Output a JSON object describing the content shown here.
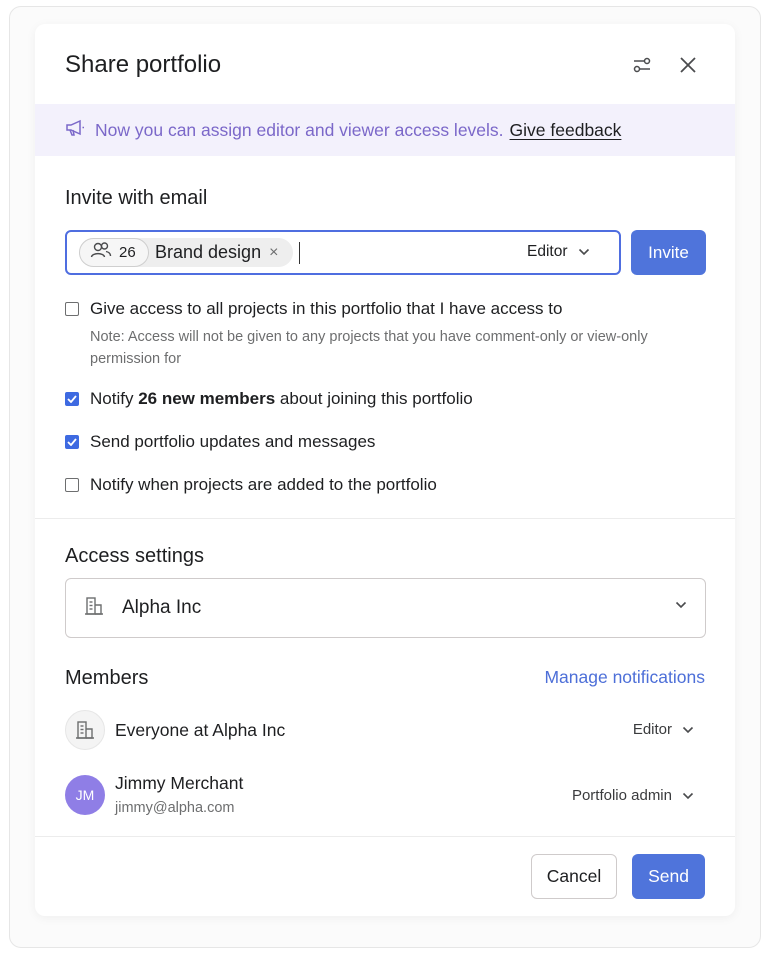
{
  "dialog": {
    "title": "Share portfolio",
    "settings_icon": "sliders-icon",
    "close_icon": "close-icon"
  },
  "banner": {
    "icon": "megaphone-icon",
    "message": "Now you can assign editor and viewer access levels.",
    "link": "Give feedback"
  },
  "invite": {
    "section_title": "Invite with email",
    "chip": {
      "icon": "team-icon",
      "count": "26",
      "label": "Brand design",
      "remove": "×"
    },
    "role": "Editor",
    "button": "Invite"
  },
  "options": [
    {
      "label": "Give access to all projects in this portfolio that I have access to",
      "checked": false
    },
    {
      "prefix": "Notify ",
      "bold": "26 new members",
      "suffix": " about joining this portfolio",
      "checked": true
    },
    {
      "label": "Send portfolio updates and messages",
      "checked": true
    },
    {
      "label": "Notify when projects are added to the portfolio",
      "checked": false
    }
  ],
  "note": "Note: Access will not be given to any projects that you have comment-only or view-only permission for",
  "access": {
    "section_title": "Access settings",
    "organization": "Alpha Inc",
    "icon": "building-icon"
  },
  "members": {
    "section_title": "Members",
    "manage_link": "Manage notifications",
    "list": [
      {
        "name": "Everyone at Alpha Inc",
        "role": "Editor",
        "icon": "building-icon"
      },
      {
        "initials": "JM",
        "name": "Jimmy Merchant",
        "email": "jimmy@alpha.com",
        "role": "Portfolio admin"
      }
    ]
  },
  "footer": {
    "cancel": "Cancel",
    "send": "Send"
  },
  "colors": {
    "primary": "#4f74db",
    "link": "#4d6fd8",
    "banner_bg": "#f3f1fc",
    "banner_text": "#7b68c9",
    "avatar": "#8f7ee6"
  }
}
